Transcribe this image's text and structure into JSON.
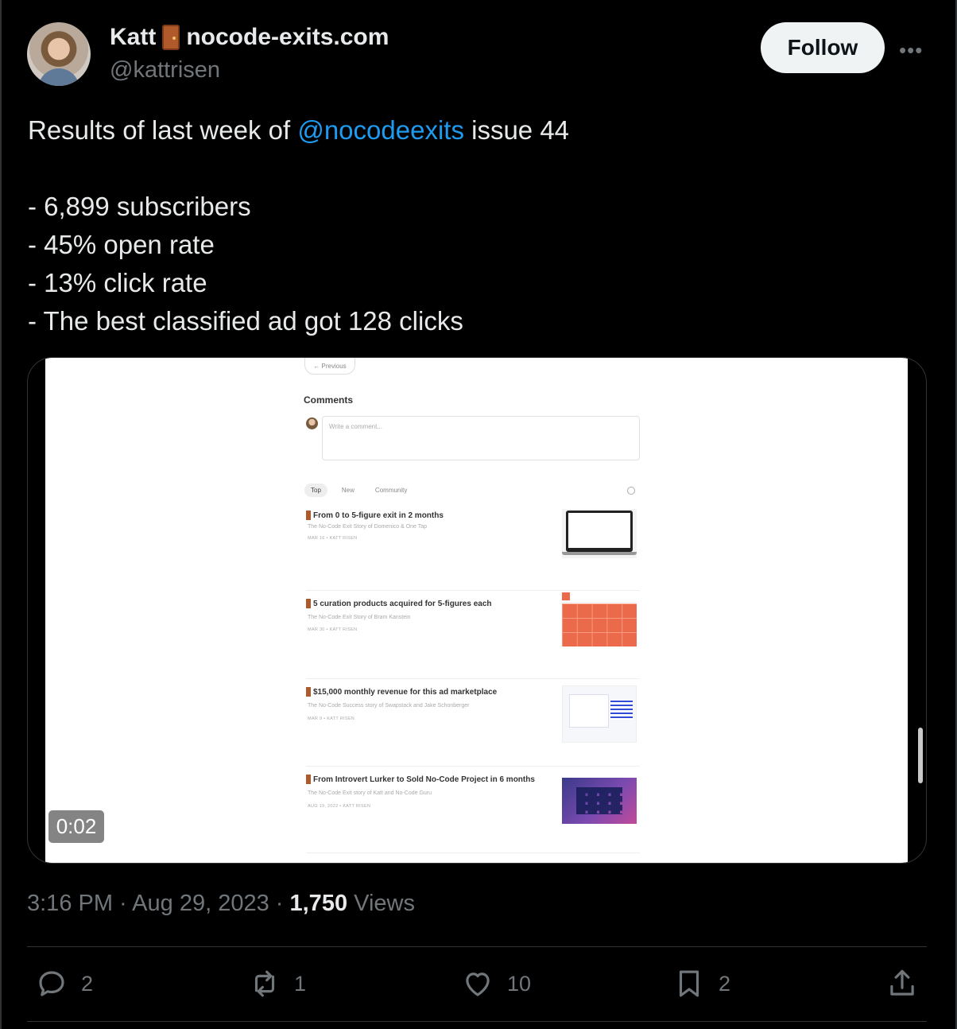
{
  "user": {
    "display_name": "Katt",
    "badge_text": "nocode-exits.com",
    "handle": "@kattrisen",
    "follow_label": "Follow",
    "more_label": "•••"
  },
  "tweet": {
    "line1_prefix": "Results of last week of ",
    "line1_mention": "@nocodeexits",
    "line1_suffix": " issue 44",
    "bullets": [
      "- 6,899 subscribers",
      "- 45% open rate",
      "- 13% click rate",
      "- The best classified ad got 128 clicks"
    ]
  },
  "media": {
    "duration": "0:02",
    "previous_label": "← Previous",
    "comments_title": "Comments",
    "comment_placeholder": "Write a comment...",
    "tabs": [
      "Top",
      "New",
      "Community"
    ],
    "posts": [
      {
        "title": "From 0 to 5-figure exit in 2 months",
        "subtitle": "The No-Code Exit Story of Domenico & One Tap",
        "meta": "MAR 16 • KATT RISEN"
      },
      {
        "title": "5 curation products acquired for 5-figures each",
        "subtitle": "The No-Code Exit Story of Bram Kanstein",
        "meta": "MAR 30 • KATT RISEN"
      },
      {
        "title": "$15,000 monthly revenue for this ad marketplace",
        "subtitle": "The No-Code Success story of Swapstack and Jake Schonberger",
        "meta": "MAR 9 • KATT RISEN"
      },
      {
        "title": "From Introvert Lurker to Sold No-Code Project in 6 months",
        "subtitle": "The No-Code Exit story of Katt and No-Code Guru",
        "meta": "AUG 19, 2022 • KATT RISEN"
      }
    ]
  },
  "meta": {
    "time": "3:16 PM",
    "date": "Aug 29, 2023",
    "views_count": "1,750",
    "views_label": "Views"
  },
  "actions": {
    "replies": "2",
    "reposts": "1",
    "likes": "10",
    "bookmarks": "2"
  }
}
